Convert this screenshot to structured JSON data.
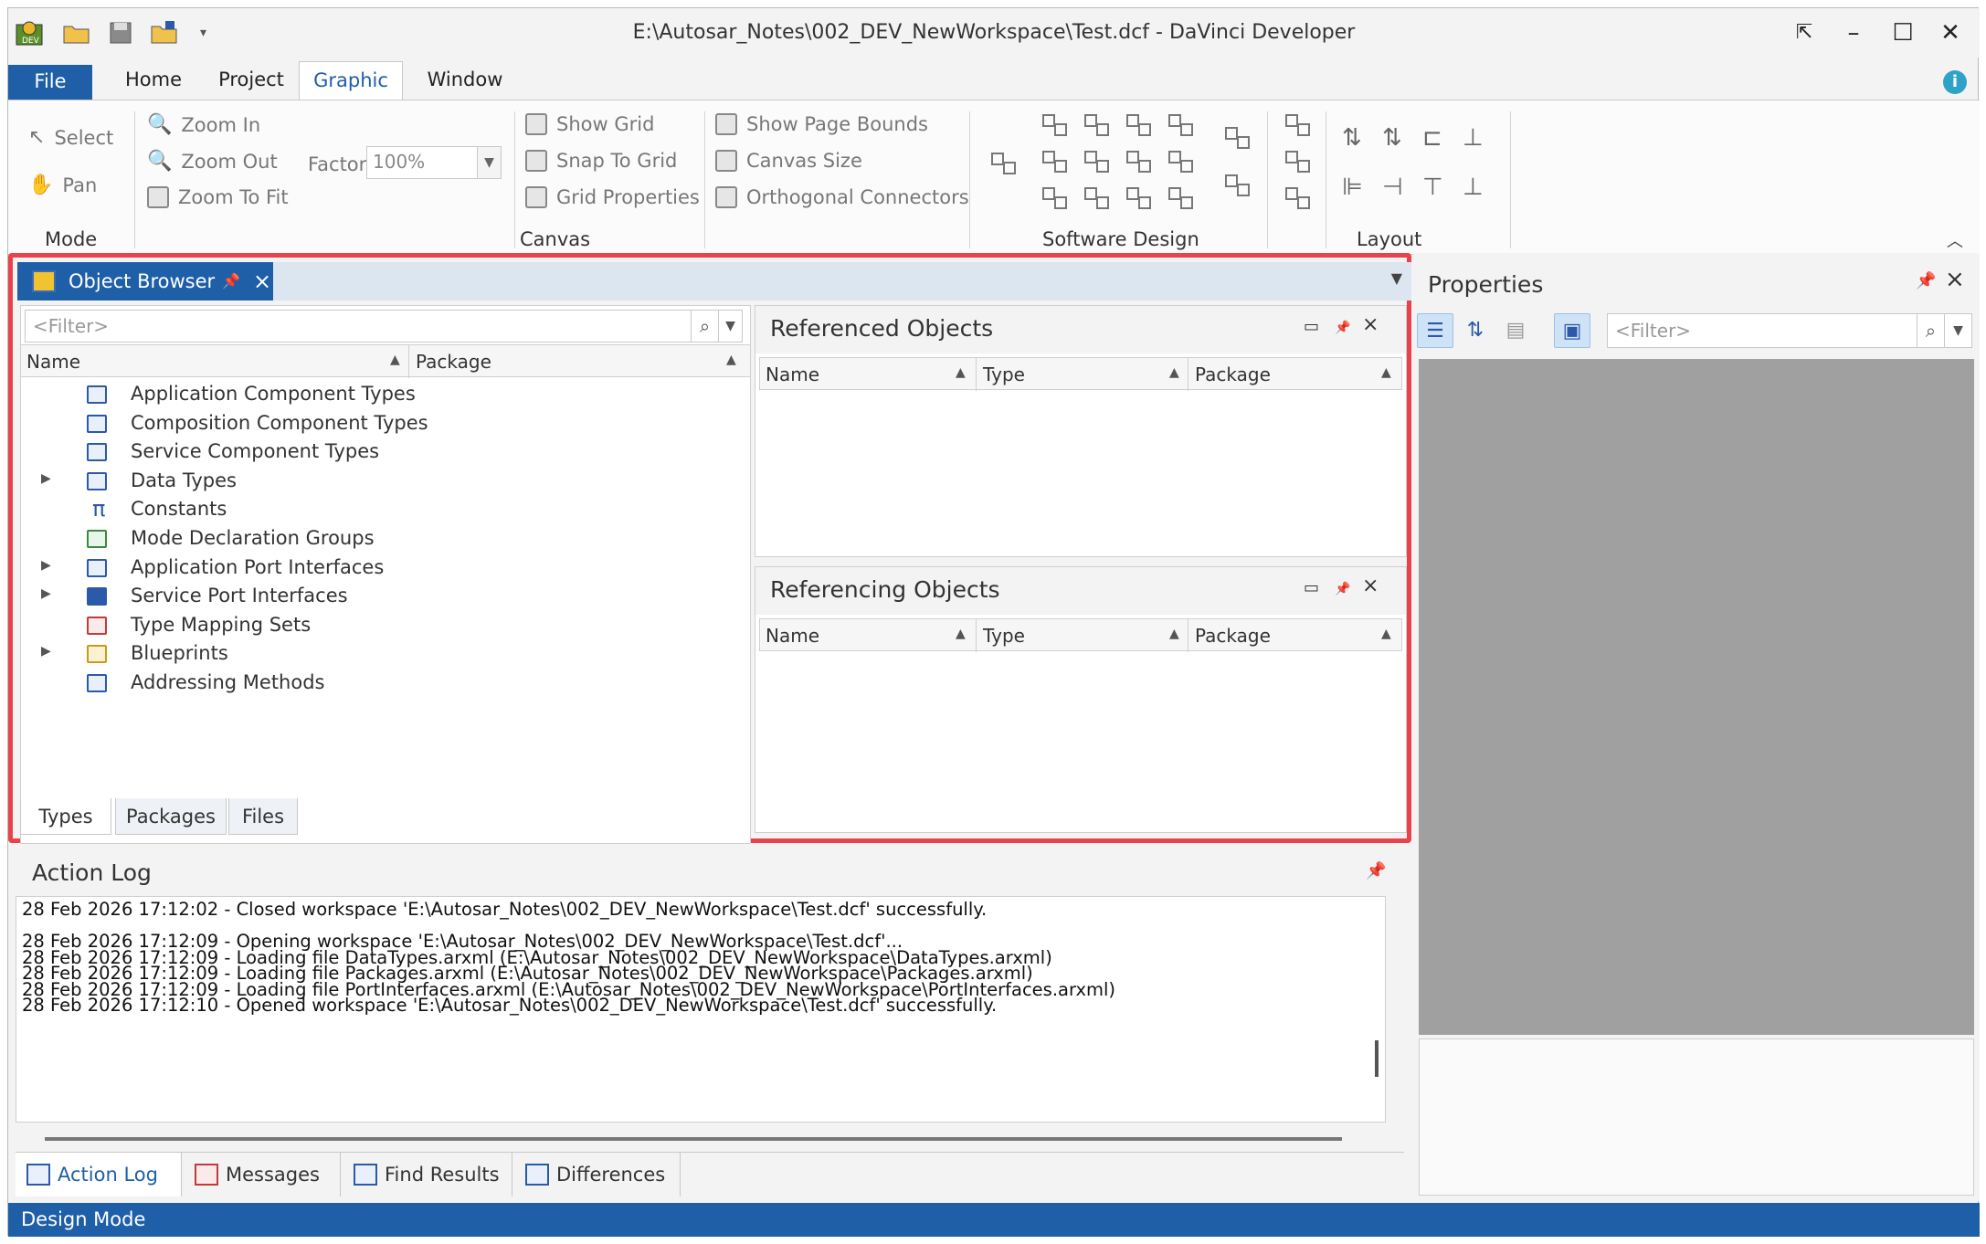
{
  "window": {
    "title": "E:\\Autosar_Notes\\002_DEV_NewWorkspace\\Test.dcf - DaVinci Developer"
  },
  "ribbon": {
    "tabs": [
      "File",
      "Home",
      "Project",
      "Graphic",
      "Window"
    ],
    "active_tab": "Graphic",
    "mode": {
      "select": "Select",
      "pan": "Pan",
      "label": "Mode"
    },
    "canvas": {
      "zoom_in": "Zoom In",
      "zoom_out": "Zoom Out",
      "zoom_to_fit": "Zoom To Fit",
      "factor_label": "Factor",
      "factor_value": "100%",
      "show_grid": "Show Grid",
      "snap_to_grid": "Snap To Grid",
      "grid_properties": "Grid Properties",
      "show_page_bounds": "Show Page Bounds",
      "canvas_size": "Canvas Size",
      "orthogonal_connectors": "Orthogonal Connectors",
      "label": "Canvas"
    },
    "software_design_label": "Software Design",
    "layout_label": "Layout"
  },
  "object_browser": {
    "tab_label": "Object Browser",
    "filter_placeholder": "<Filter>",
    "columns": {
      "name": "Name",
      "package": "Package"
    },
    "items": [
      {
        "label": "Application Component Types",
        "expandable": false
      },
      {
        "label": "Composition Component Types",
        "expandable": false
      },
      {
        "label": "Service Component Types",
        "expandable": false
      },
      {
        "label": "Data Types",
        "expandable": true
      },
      {
        "label": "Constants",
        "expandable": false
      },
      {
        "label": "Mode Declaration Groups",
        "expandable": false
      },
      {
        "label": "Application Port Interfaces",
        "expandable": true
      },
      {
        "label": "Service Port Interfaces",
        "expandable": true
      },
      {
        "label": "Type Mapping Sets",
        "expandable": false
      },
      {
        "label": "Blueprints",
        "expandable": true
      },
      {
        "label": "Addressing Methods",
        "expandable": false
      }
    ],
    "bottom_tabs": [
      "Types",
      "Packages",
      "Files"
    ],
    "active_bottom_tab": "Types",
    "referenced": {
      "title": "Referenced Objects",
      "cols": [
        "Name",
        "Type",
        "Package"
      ]
    },
    "referencing": {
      "title": "Referencing Objects",
      "cols": [
        "Name",
        "Type",
        "Package"
      ]
    }
  },
  "properties": {
    "title": "Properties",
    "filter_placeholder": "<Filter>"
  },
  "action_log": {
    "title": "Action Log",
    "lines": [
      "28 Feb 2026 17:12:02 - Closed workspace 'E:\\Autosar_Notes\\002_DEV_NewWorkspace\\Test.dcf' successfully.",
      "",
      "28 Feb 2026 17:12:09 - Opening workspace 'E:\\Autosar_Notes\\002_DEV_NewWorkspace\\Test.dcf'...",
      "28 Feb 2026 17:12:09 - Loading file DataTypes.arxml (E:\\Autosar_Notes\\002_DEV_NewWorkspace\\DataTypes.arxml)",
      "28 Feb 2026 17:12:09 - Loading file Packages.arxml (E:\\Autosar_Notes\\002_DEV_NewWorkspace\\Packages.arxml)",
      "28 Feb 2026 17:12:09 - Loading file PortInterfaces.arxml (E:\\Autosar_Notes\\002_DEV_NewWorkspace\\PortInterfaces.arxml)",
      "28 Feb 2026 17:12:10 - Opened workspace 'E:\\Autosar_Notes\\002_DEV_NewWorkspace\\Test.dcf' successfully."
    ],
    "tabs": [
      "Action Log",
      "Messages",
      "Find Results",
      "Differences"
    ],
    "active_tab": "Action Log"
  },
  "status": {
    "text": "Design Mode"
  },
  "colors": {
    "accent": "#1f5fa8",
    "highlight": "#e8434a",
    "properties_bg": "#a0a0a0"
  }
}
